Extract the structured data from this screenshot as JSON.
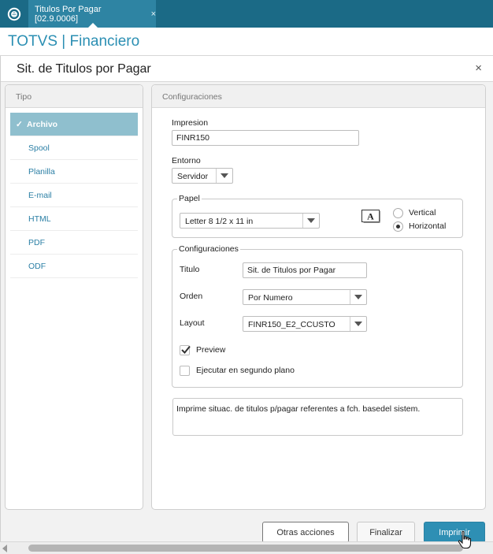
{
  "tab": {
    "label": "Titulos Por Pagar [02.9.0006]",
    "close": "×"
  },
  "app": {
    "title": "TOTVS | Financiero"
  },
  "dialog": {
    "title": "Sit. de Titulos por Pagar",
    "close": "×"
  },
  "tipo": {
    "header": "Tipo",
    "check": "✓",
    "items": [
      {
        "label": "Archivo",
        "selected": true
      },
      {
        "label": "Spool"
      },
      {
        "label": "Planilla"
      },
      {
        "label": "E-mail"
      },
      {
        "label": "HTML"
      },
      {
        "label": "PDF"
      },
      {
        "label": "ODF"
      }
    ]
  },
  "config": {
    "header": "Configuraciones",
    "impresion": {
      "label": "Impresion",
      "value": "FINR150"
    },
    "entorno": {
      "label": "Entorno",
      "value": "Servidor"
    },
    "papel": {
      "legend": "Papel",
      "size": "Letter 8 1/2 x 11 in",
      "orientation_icon_letter": "A",
      "vertical": "Vertical",
      "horizontal": "Horizontal",
      "selected": "Horizontal"
    },
    "configuraciones": {
      "legend": "Configuraciones",
      "titulo": {
        "label": "Titulo",
        "value": "Sit. de Titulos por Pagar"
      },
      "orden": {
        "label": "Orden",
        "value": "Por Numero"
      },
      "layout": {
        "label": "Layout",
        "value": "FINR150_E2_CCUSTO"
      },
      "preview": {
        "label": "Preview",
        "checked": true
      },
      "segundo_plano": {
        "label": "Ejecutar en segundo plano",
        "checked": false
      }
    },
    "description": "Imprime situac. de titulos p/pagar referentes a fch. basedel sistem."
  },
  "buttons": {
    "otras": "Otras acciones",
    "finalizar": "Finalizar",
    "imprimir": "Imprimir"
  },
  "colors": {
    "topbar": "#1b6a86",
    "tab_active": "#2e84a3",
    "accent": "#2b8fb3",
    "selected_item": "#8fbfce",
    "primary_button": "#2e8fb4"
  }
}
